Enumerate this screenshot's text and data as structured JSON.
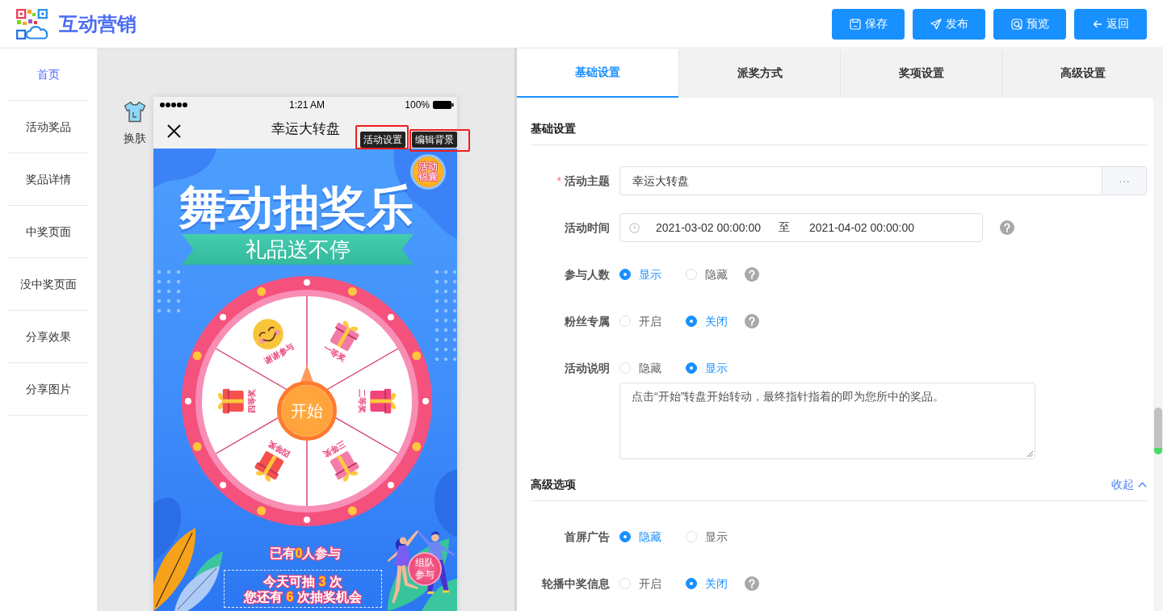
{
  "header": {
    "title": "互动营销",
    "buttons": [
      {
        "label": "保存",
        "kind": "save"
      },
      {
        "label": "发布",
        "kind": "publish"
      },
      {
        "label": "预览",
        "kind": "preview"
      },
      {
        "label": "返回",
        "kind": "back"
      }
    ]
  },
  "sidebar": {
    "items": [
      {
        "label": "首页",
        "selected": true
      },
      {
        "label": "活动奖品",
        "selected": false
      },
      {
        "label": "奖品详情",
        "selected": false
      },
      {
        "label": "中奖页面",
        "selected": false
      },
      {
        "label": "没中奖页面",
        "selected": false
      },
      {
        "label": "分享效果",
        "selected": false
      },
      {
        "label": "分享图片",
        "selected": false
      }
    ]
  },
  "preview": {
    "skin_button": "换肤",
    "overlay_tags": [
      "活动设置",
      "编辑背景"
    ],
    "phone": {
      "status_bar": {
        "time": "1:21 AM",
        "battery": "100%"
      },
      "nav_title": "幸运大转盘",
      "poster": {
        "badge": "活动锦囊",
        "headline": "舞动抽奖乐",
        "ribbon": "礼品送不停",
        "wheel": {
          "start": "开始",
          "prizes": [
            {
              "label": "谢谢参与",
              "kind": "smile",
              "color": "#f8c53a"
            },
            {
              "label": "一等奖",
              "kind": "gift",
              "color": "#f27aa6"
            },
            {
              "label": "二等奖",
              "kind": "gift",
              "color": "#f0457a"
            },
            {
              "label": "三等奖",
              "kind": "gift",
              "color": "#f57ca9"
            },
            {
              "label": "四等奖",
              "kind": "gift",
              "color": "#f5504a"
            },
            {
              "label": "四等奖",
              "kind": "gift",
              "color": "#f5504a"
            }
          ]
        },
        "participants": {
          "before": "已有",
          "count": "0",
          "after": "人参与"
        },
        "chances": [
          {
            "before": "今天可抽 ",
            "count": "3",
            "after": " 次"
          },
          {
            "before": "您还有 ",
            "count": "6",
            "after": " 次抽奖机会"
          }
        ],
        "team_button": "组队参与"
      }
    }
  },
  "tabs": [
    {
      "label": "基础设置",
      "selected": true
    },
    {
      "label": "派奖方式",
      "selected": false
    },
    {
      "label": "奖项设置",
      "selected": false
    },
    {
      "label": "高级设置",
      "selected": false
    }
  ],
  "sections": [
    {
      "title": "基础设置",
      "fields": [
        {
          "kind": "text",
          "label": "活动主题",
          "required_mark": "*",
          "value": "幸运大转盘",
          "append": "···"
        },
        {
          "kind": "date_range",
          "label": "活动时间",
          "start": "2021-03-02 00:00:00",
          "separator": "至",
          "end": "2021-04-02 00:00:00",
          "help": true
        },
        {
          "kind": "radio",
          "label": "参与人数",
          "options": [
            {
              "label": "显示",
              "selected": true
            },
            {
              "label": "隐藏",
              "selected": false
            }
          ],
          "help": true
        },
        {
          "kind": "radio",
          "label": "粉丝专属",
          "options": [
            {
              "label": "开启",
              "selected": false
            },
            {
              "label": "关闭",
              "selected": true
            }
          ],
          "help": true
        },
        {
          "kind": "radio",
          "label": "活动说明",
          "options": [
            {
              "label": "隐藏",
              "selected": false
            },
            {
              "label": "显示",
              "selected": true
            }
          ]
        },
        {
          "kind": "textarea",
          "value": "点击“开始”转盘开始转动，最终指针指着的即为您所中的奖品。"
        }
      ]
    },
    {
      "title": "高级选项",
      "toggle": {
        "label": "收起",
        "expanded": true
      },
      "fields": [
        {
          "kind": "radio",
          "label": "首屏广告",
          "options": [
            {
              "label": "隐藏",
              "selected": true
            },
            {
              "label": "显示",
              "selected": false
            }
          ]
        },
        {
          "kind": "radio",
          "label": "轮播中奖信息",
          "options": [
            {
              "label": "开启",
              "selected": false
            },
            {
              "label": "关闭",
              "selected": true
            }
          ],
          "help": true
        }
      ]
    }
  ]
}
